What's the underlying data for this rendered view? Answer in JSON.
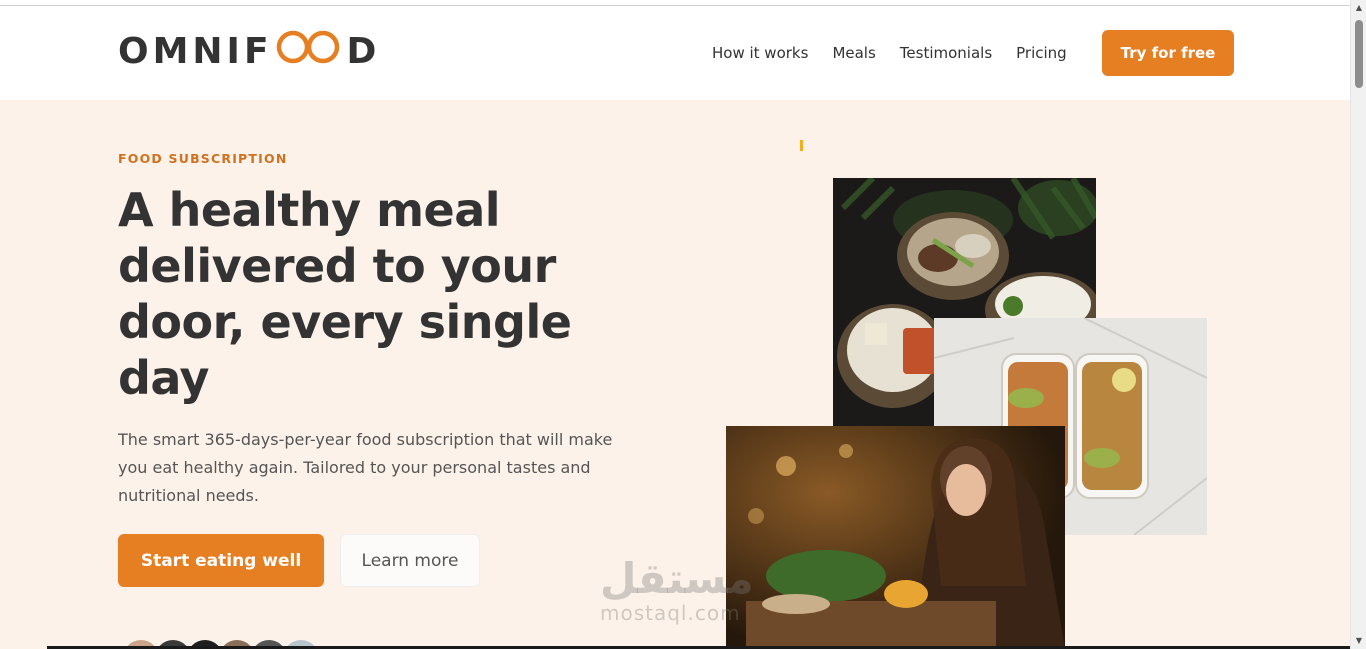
{
  "header": {
    "logo_text_left": "OMNIF",
    "logo_text_right": "D",
    "nav": [
      {
        "label": "How it works"
      },
      {
        "label": "Meals"
      },
      {
        "label": "Testimonials"
      },
      {
        "label": "Pricing"
      }
    ],
    "cta_label": "Try for free"
  },
  "hero": {
    "eyebrow": "FOOD SUBSCRIPTION",
    "title": "A healthy meal delivered to your door, every single day",
    "description": "The smart 365-days-per-year food subscription that will make you eat healthy again. Tailored to your personal tastes and nutritional needs.",
    "primary_button": "Start eating well",
    "secondary_button": "Learn more"
  },
  "watermark": {
    "arabic": "مستقل",
    "latin": "mostaql.com"
  },
  "colors": {
    "accent": "#e67e22",
    "eyebrow": "#cf711f",
    "hero_bg": "#fdf2e9",
    "text_dark": "#333333"
  },
  "icons": {
    "logo_mark": "infinity-icon"
  }
}
